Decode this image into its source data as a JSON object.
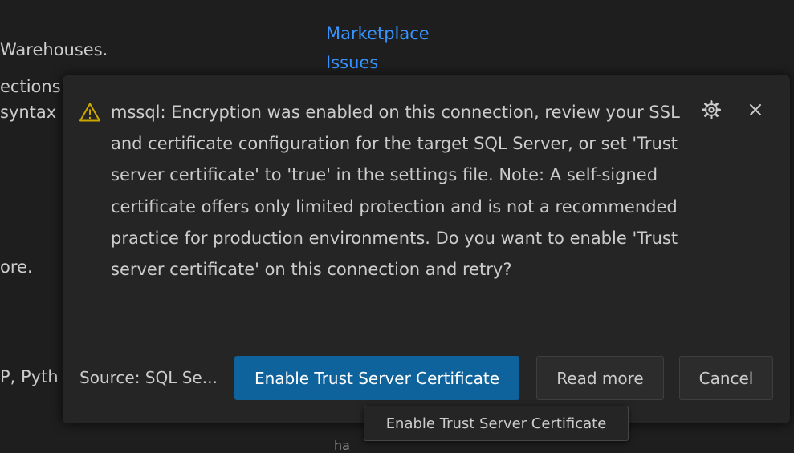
{
  "background": {
    "text_warehouses": "Warehouses.",
    "text_ections": "ections",
    "text_syntax": "syntax",
    "text_ore": "ore.",
    "text_pyth": "P, Pyth",
    "text_bottom_fragment": "ha",
    "link_marketplace": "Marketplace",
    "link_issues": "Issues"
  },
  "notification": {
    "message": "mssql: Encryption was enabled on this connection, review your SSL and certificate configuration for the target SQL Server, or set 'Trust server certificate' to 'true' in the settings file. Note: A self-signed certificate offers only limited protection and is not a recommended practice for production environments. Do you want to enable 'Trust server certificate' on this connection and retry?",
    "source": "Source: SQL Se...",
    "primary_button": "Enable Trust Server Certificate",
    "read_more_button": "Read more",
    "cancel_button": "Cancel",
    "tooltip": "Enable Trust Server Certificate"
  },
  "colors": {
    "editor_background": "#1e1e1e",
    "toast_background": "#252526",
    "primary_button": "#0e639c",
    "link": "#3794ff",
    "warning": "#cca700"
  },
  "icons": {
    "warning": "warning-icon",
    "settings": "gear-icon",
    "close": "close-icon"
  }
}
